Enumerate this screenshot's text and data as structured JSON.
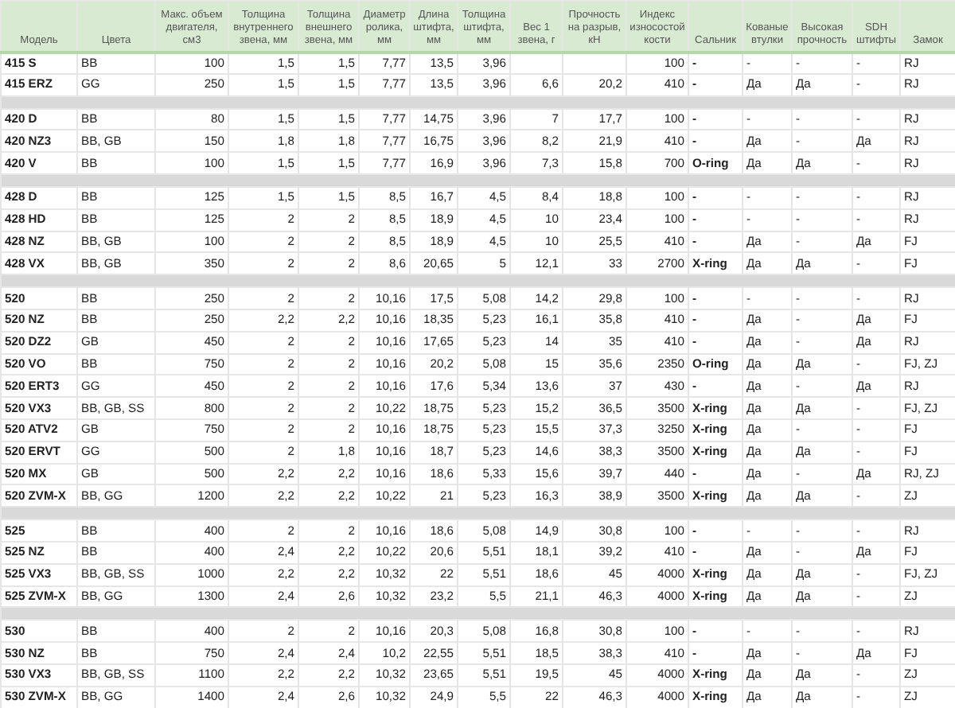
{
  "table": {
    "columns": [
      "Модель",
      "Цвета",
      "Макс. объем двигателя, см3",
      "Толщина внутреннего звена, мм",
      "Толщина внешнего звена, мм",
      "Диаметр ролика, мм",
      "Длина штифта, мм",
      "Толщина штифта, мм",
      "Вес 1 звена, г",
      "Прочность на разрыв, кН",
      "Индекс износостой кости",
      "Сальник",
      "Кованые втулки",
      "Высокая прочность",
      "SDH штифты",
      "Замок"
    ],
    "groups": [
      {
        "rows": [
          {
            "cells": [
              "415 S",
              "BB",
              "100",
              "1,5",
              "1,5",
              "7,77",
              "13,5",
              "3,96",
              null,
              null,
              "100",
              "-",
              "-",
              "-",
              "-",
              "RJ"
            ]
          },
          {
            "cells": [
              "415 ERZ",
              "GG",
              "250",
              "1,5",
              "1,5",
              "7,77",
              "13,5",
              "3,96",
              "6,6",
              "20,2",
              "410",
              "-",
              "Да",
              "Да",
              "-",
              "RJ"
            ]
          }
        ]
      },
      {
        "rows": [
          {
            "cells": [
              "420 D",
              "BB",
              "80",
              "1,5",
              "1,5",
              "7,77",
              "14,75",
              "3,96",
              "7",
              "17,7",
              "100",
              "-",
              "-",
              "-",
              "-",
              "RJ"
            ]
          },
          {
            "cells": [
              "420 NZ3",
              "BB, GB",
              "150",
              "1,8",
              "1,8",
              "7,77",
              "16,75",
              "3,96",
              "8,2",
              "21,9",
              "410",
              "-",
              "Да",
              "-",
              "Да",
              "RJ"
            ]
          },
          {
            "cells": [
              "420 V",
              "BB",
              "100",
              "1,5",
              "1,5",
              "7,77",
              "16,9",
              "3,96",
              "7,3",
              "15,8",
              "700",
              "O-ring",
              "Да",
              "Да",
              "-",
              "RJ"
            ]
          }
        ]
      },
      {
        "rows": [
          {
            "cells": [
              "428 D",
              "BB",
              "125",
              "1,5",
              "1,5",
              "8,5",
              "16,7",
              "4,5",
              "8,4",
              "18,8",
              "100",
              "-",
              "-",
              "-",
              "-",
              "RJ"
            ]
          },
          {
            "cells": [
              "428 HD",
              "BB",
              "125",
              "2",
              "2",
              "8,5",
              "18,9",
              "4,5",
              "10",
              "23,4",
              "100",
              "-",
              "-",
              "-",
              "-",
              "RJ"
            ]
          },
          {
            "cells": [
              "428 NZ",
              "BB, GB",
              "100",
              "2",
              "2",
              "8,5",
              "18,9",
              "4,5",
              "10",
              "25,5",
              "410",
              "-",
              "Да",
              "-",
              "Да",
              "FJ"
            ]
          },
          {
            "cells": [
              "428 VX",
              "BB, GB",
              "350",
              "2",
              "2",
              "8,6",
              "20,65",
              "5",
              "12,1",
              "33",
              "2700",
              "X-ring",
              "Да",
              "Да",
              "-",
              "FJ"
            ]
          }
        ]
      },
      {
        "rows": [
          {
            "cells": [
              "520",
              "BB",
              "250",
              "2",
              "2",
              "10,16",
              "17,5",
              "5,08",
              "14,2",
              "29,8",
              "100",
              "-",
              "-",
              "-",
              "-",
              "RJ"
            ]
          },
          {
            "cells": [
              "520 NZ",
              "BB",
              "250",
              "2,2",
              "2,2",
              "10,16",
              "18,35",
              "5,23",
              "16,1",
              "35,8",
              "410",
              "-",
              "Да",
              "-",
              "Да",
              "FJ"
            ]
          },
          {
            "cells": [
              "520 DZ2",
              "GB",
              "450",
              "2",
              "2",
              "10,16",
              "17,65",
              "5,23",
              "14",
              "35",
              "410",
              "-",
              "Да",
              "-",
              "Да",
              "RJ"
            ]
          },
          {
            "cells": [
              "520 VO",
              "BB",
              "750",
              "2",
              "2",
              "10,16",
              "20,2",
              "5,08",
              "15",
              "35,6",
              "2350",
              "O-ring",
              "Да",
              "Да",
              "-",
              "FJ, ZJ"
            ]
          },
          {
            "cells": [
              "520 ERT3",
              "GG",
              "450",
              "2",
              "2",
              "10,16",
              "17,6",
              "5,34",
              "13,6",
              "37",
              "430",
              "-",
              "Да",
              "-",
              "Да",
              "RJ"
            ]
          },
          {
            "cells": [
              "520 VX3",
              "BB, GB, SS",
              "800",
              "2",
              "2",
              "10,22",
              "18,75",
              "5,23",
              "15,2",
              "36,5",
              "3500",
              "X-ring",
              "Да",
              "Да",
              "-",
              "FJ, ZJ"
            ]
          },
          {
            "cells": [
              "520 ATV2",
              "GB",
              "750",
              "2",
              "2",
              "10,16",
              "18,75",
              "5,23",
              "15,5",
              "37,3",
              "3250",
              "X-ring",
              "Да",
              "-",
              "-",
              "FJ"
            ]
          },
          {
            "cells": [
              "520 ERVT",
              "GG",
              "500",
              "2",
              "1,8",
              "10,16",
              "18,7",
              "5,23",
              "14,6",
              "38,3",
              "3500",
              "X-ring",
              "Да",
              "Да",
              "-",
              "FJ"
            ]
          },
          {
            "cells": [
              "520 MX",
              "GB",
              "500",
              "2,2",
              "2,2",
              "10,16",
              "18,6",
              "5,33",
              "15,6",
              "39,7",
              "440",
              "-",
              "Да",
              "-",
              "Да",
              "RJ, ZJ"
            ]
          },
          {
            "cells": [
              "520 ZVM-X",
              "BB, GG",
              "1200",
              "2,2",
              "2,2",
              "10,22",
              "21",
              "5,23",
              "16,3",
              "38,9",
              "3500",
              "X-ring",
              "Да",
              "Да",
              "-",
              "ZJ"
            ]
          }
        ]
      },
      {
        "rows": [
          {
            "cells": [
              "525",
              "BB",
              "400",
              "2",
              "2",
              "10,16",
              "18,6",
              "5,08",
              "14,9",
              "30,8",
              "100",
              "-",
              "-",
              "-",
              "-",
              "RJ"
            ]
          },
          {
            "cells": [
              "525 NZ",
              "BB",
              "400",
              "2,4",
              "2,2",
              "10,22",
              "20,6",
              "5,51",
              "18,1",
              "39,2",
              "410",
              "-",
              "Да",
              "-",
              "Да",
              "FJ"
            ]
          },
          {
            "cells": [
              "525 VX3",
              "BB, GB, SS",
              "1000",
              "2,2",
              "2,2",
              "10,32",
              "22",
              "5,51",
              "18,6",
              "45",
              "4000",
              "X-ring",
              "Да",
              "Да",
              "-",
              "FJ, ZJ"
            ]
          },
          {
            "cells": [
              "525 ZVM-X",
              "BB, GG",
              "1300",
              "2,4",
              "2,6",
              "10,32",
              "23,2",
              "5,5",
              "21,1",
              "46,3",
              "4000",
              "X-ring",
              "Да",
              "Да",
              "-",
              "ZJ"
            ]
          }
        ]
      },
      {
        "rows": [
          {
            "cells": [
              "530",
              "BB",
              "400",
              "2",
              "2",
              "10,16",
              "20,3",
              "5,08",
              "16,8",
              "30,8",
              "100",
              "-",
              "-",
              "-",
              "-",
              "RJ"
            ]
          },
          {
            "cells": [
              "530 NZ",
              "BB",
              "750",
              "2,4",
              "2,4",
              "10,2",
              "22,55",
              "5,51",
              "18,5",
              "38,3",
              "410",
              "-",
              "Да",
              "-",
              "Да",
              "FJ"
            ]
          },
          {
            "cells": [
              "530 VX3",
              "BB, GB, SS",
              "1100",
              "2,2",
              "2,2",
              "10,32",
              "23,65",
              "5,51",
              "19,5",
              "45",
              "4000",
              "X-ring",
              "Да",
              "Да",
              "-",
              "ZJ"
            ]
          },
          {
            "cells": [
              "530 ZVM-X",
              "BB, GG",
              "1400",
              "2,4",
              "2,6",
              "10,32",
              "24,9",
              "5,5",
              "22",
              "46,3",
              "4000",
              "X-ring",
              "Да",
              "Да",
              "-",
              "ZJ"
            ]
          }
        ]
      }
    ]
  }
}
